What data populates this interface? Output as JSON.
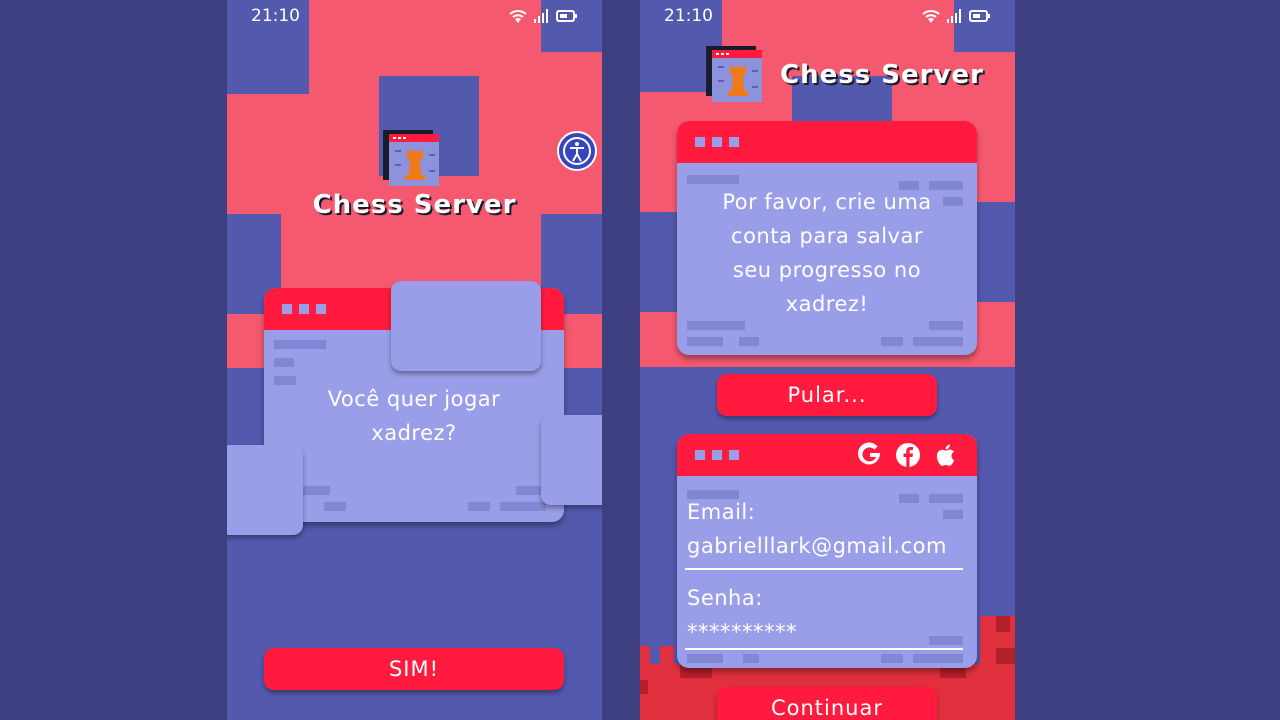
{
  "status": {
    "time": "21:10"
  },
  "app": {
    "title": "Chess Server"
  },
  "screen1": {
    "question": "Você quer jogar xadrez?",
    "yes_button": "SIM!"
  },
  "screen2": {
    "message": "Por favor, crie uma conta para salvar seu progresso no xadrez!",
    "skip_button": "Pular...",
    "social_icons": [
      "google-icon",
      "facebook-icon",
      "apple-icon"
    ],
    "email_label": "Email:",
    "email_value": "gabrielllark@gmail.com",
    "password_label": "Senha:",
    "password_value": "**********",
    "continue_button": "Continuar"
  },
  "colors": {
    "background": "#3d3f80",
    "screen_blue": "#5359ad",
    "pink": "#f4596f",
    "accent_red": "#ff1a3e",
    "card_lavender": "#9a9ee8",
    "logo_rook": "#f07a1a"
  }
}
